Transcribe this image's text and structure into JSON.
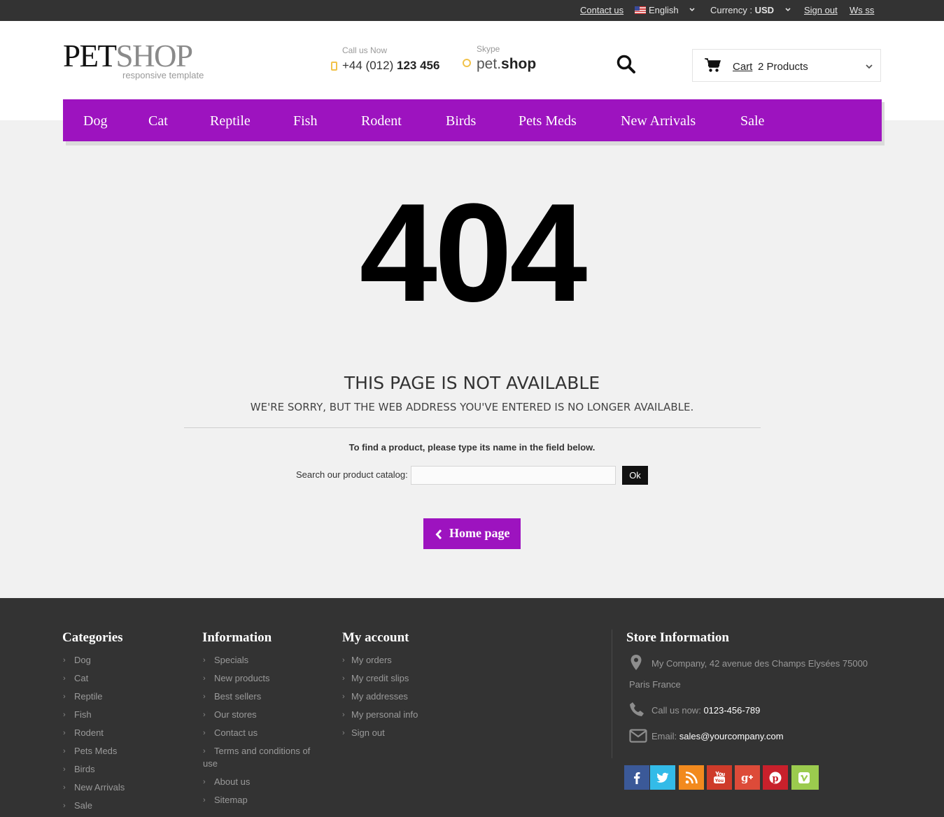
{
  "topbar": {
    "contact": "Contact us",
    "language": "English",
    "currency_label": "Currency :",
    "currency_value": "USD",
    "sign_out": "Sign out",
    "user": "Ws ss"
  },
  "header": {
    "logo_dark": "PET",
    "logo_light": "SHOP",
    "logo_tagline": "responsive template",
    "call_label": "Call us Now",
    "call_prefix": "+44 (012)",
    "call_number": "123 456",
    "skype_label": "Skype",
    "skype_prefix": "pet.",
    "skype_name": "shop",
    "cart_label": "Cart",
    "cart_count": "2 Products"
  },
  "nav": {
    "items": [
      "Dog",
      "Cat",
      "Reptile",
      "Fish",
      "Rodent",
      "Birds",
      "Pets Meds",
      "New Arrivals",
      "Sale"
    ]
  },
  "main": {
    "error_code": "404",
    "title": "THIS PAGE IS NOT AVAILABLE",
    "subtitle": "WE'RE SORRY, BUT THE WEB ADDRESS YOU'VE ENTERED IS NO LONGER AVAILABLE.",
    "hint": "To find a product, please type its name in the field below.",
    "search_label": "Search our product catalog:",
    "search_value": "",
    "ok_label": "Ok",
    "home_label": "Home page"
  },
  "footer": {
    "categories": {
      "title": "Categories",
      "items": [
        "Dog",
        "Cat",
        "Reptile",
        "Fish",
        "Rodent",
        "Pets Meds",
        "Birds",
        "New Arrivals",
        "Sale"
      ]
    },
    "information": {
      "title": "Information",
      "items": [
        "Specials",
        "New products",
        "Best sellers",
        "Our stores",
        "Contact us",
        "Terms and conditions of",
        "use",
        "About us",
        "Sitemap"
      ]
    },
    "account": {
      "title": "My account",
      "items": [
        "My orders",
        "My credit slips",
        "My addresses",
        "My personal info",
        "Sign out"
      ]
    },
    "store": {
      "title": "Store Information",
      "address_line1": "My Company, 42 avenue des Champs Elysées 75000",
      "address_line2": "Paris France",
      "call_label": "Call us now:",
      "call_value": "0123-456-789",
      "email_label": "Email:",
      "email_value": "sales@yourcompany.com"
    },
    "social": [
      {
        "icon": "facebook-icon",
        "color": "#3b5998"
      },
      {
        "icon": "twitter-icon",
        "color": "#33bbe8"
      },
      {
        "icon": "rss-icon",
        "color": "#f28a1e"
      },
      {
        "icon": "youtube-icon",
        "color": "#ce3b2a"
      },
      {
        "icon": "google-plus-icon",
        "color": "#dd4b39"
      },
      {
        "icon": "pinterest-icon",
        "color": "#c8202b"
      },
      {
        "icon": "vimeo-icon",
        "color": "#9bcb4e"
      }
    ]
  },
  "colors": {
    "accent": "#9d13bf",
    "topbar": "#333333",
    "footer": "#333333",
    "background": "#f1f1f1"
  }
}
